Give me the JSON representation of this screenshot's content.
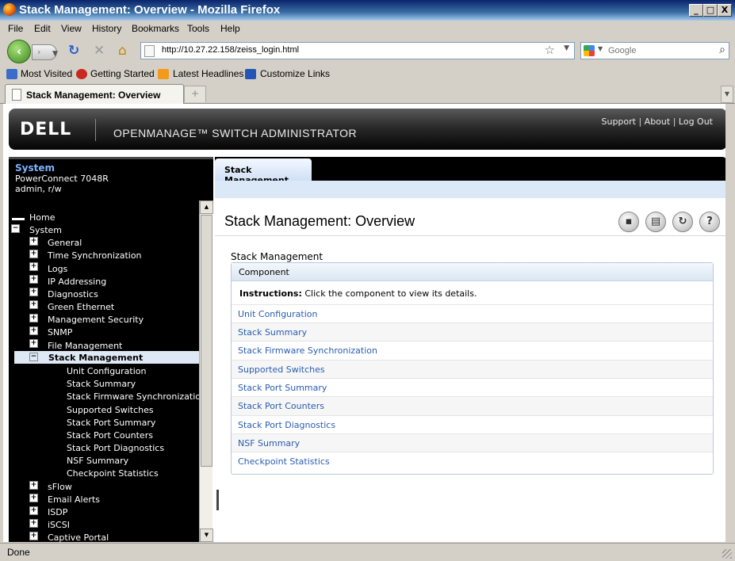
{
  "window": {
    "title": "Stack Management: Overview - Mozilla Firefox",
    "minimize": "_",
    "maximize": "□",
    "close": "X"
  },
  "menu": [
    "File",
    "Edit",
    "View",
    "History",
    "Bookmarks",
    "Tools",
    "Help"
  ],
  "navigation": {
    "url": "http://10.27.22.158/zeiss_login.html",
    "search_placeholder": "Google"
  },
  "bookmarks": [
    "Most Visited",
    "Getting Started",
    "Latest Headlines",
    "Customize Links"
  ],
  "tabs": [
    {
      "label": "Stack Management: Overview"
    }
  ],
  "header": {
    "logo": "DELL",
    "product": "OPENMANAGE™ SWITCH ADMINISTRATOR",
    "links": [
      "Support",
      "About",
      "Log Out"
    ]
  },
  "system_info": {
    "heading": "System",
    "model": "PowerConnect 7048R",
    "user": "admin, r/w"
  },
  "tree": {
    "home": "Home",
    "system": "System",
    "items_before": [
      "General",
      "Time Synchronization",
      "Logs",
      "IP Addressing",
      "Diagnostics",
      "Green Ethernet",
      "Management Security",
      "SNMP",
      "File Management"
    ],
    "selected": "Stack Management",
    "children": [
      "Unit Configuration",
      "Stack Summary",
      "Stack Firmware Synchronization",
      "Supported Switches",
      "Stack Port Summary",
      "Stack Port Counters",
      "Stack Port Diagnostics",
      "NSF Summary",
      "Checkpoint Statistics"
    ],
    "items_after": [
      "sFlow",
      "Email Alerts",
      "ISDP",
      "iSCSI",
      "Captive Portal"
    ]
  },
  "content": {
    "tab_label": "Stack Management",
    "page_title": "Stack Management: Overview",
    "section_title": "Stack Management",
    "table_header": "Component",
    "instructions_bold": "Instructions:",
    "instructions_text": " Click the component to view its details.",
    "components": [
      "Unit Configuration",
      "Stack Summary",
      "Stack Firmware Synchronization",
      "Supported Switches",
      "Stack Port Summary",
      "Stack Port Counters",
      "Stack Port Diagnostics",
      "NSF Summary",
      "Checkpoint Statistics"
    ]
  },
  "status": "Done"
}
